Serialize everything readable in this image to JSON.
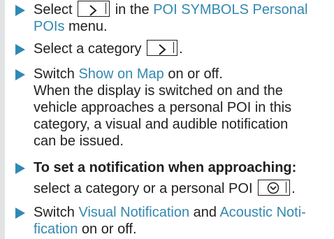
{
  "steps": [
    {
      "line1_pre": "Select",
      "line1_post": "in the",
      "line1_hl": "POI SYMBOLS Personal",
      "line2_hl": "POIs",
      "line2_post": " menu."
    },
    {
      "line1_pre": "Select a category",
      "line1_post": "."
    },
    {
      "line1_pre": "Switch ",
      "line1_hl": "Show on Map",
      "line1_post": " on or off.",
      "body_lines": [
        "When the display is switched on and the",
        "vehicle approaches a personal POI in this",
        "category, a visual and audible notification",
        "can be issued."
      ]
    },
    {
      "line1_bold": "To set a notification when approaching:",
      "line2_pre": "select a category or a personal POI",
      "line2_post": "."
    },
    {
      "line1_pre": "Switch ",
      "line1_hl1": "Visual Notification",
      "line1_mid": " and ",
      "line1_hl2": "Acoustic Noti-",
      "line2_hl": "fication",
      "line2_post": " on or off."
    }
  ],
  "icons": {
    "bullet": "triangle-arrow-icon",
    "button_forward": "chevron-right-icon",
    "button_select": "circle-chevron-down-icon"
  },
  "colors": {
    "highlight": "#3388b0",
    "bullet": "#2f8ab5",
    "sidebar": "#e1e3e5"
  }
}
